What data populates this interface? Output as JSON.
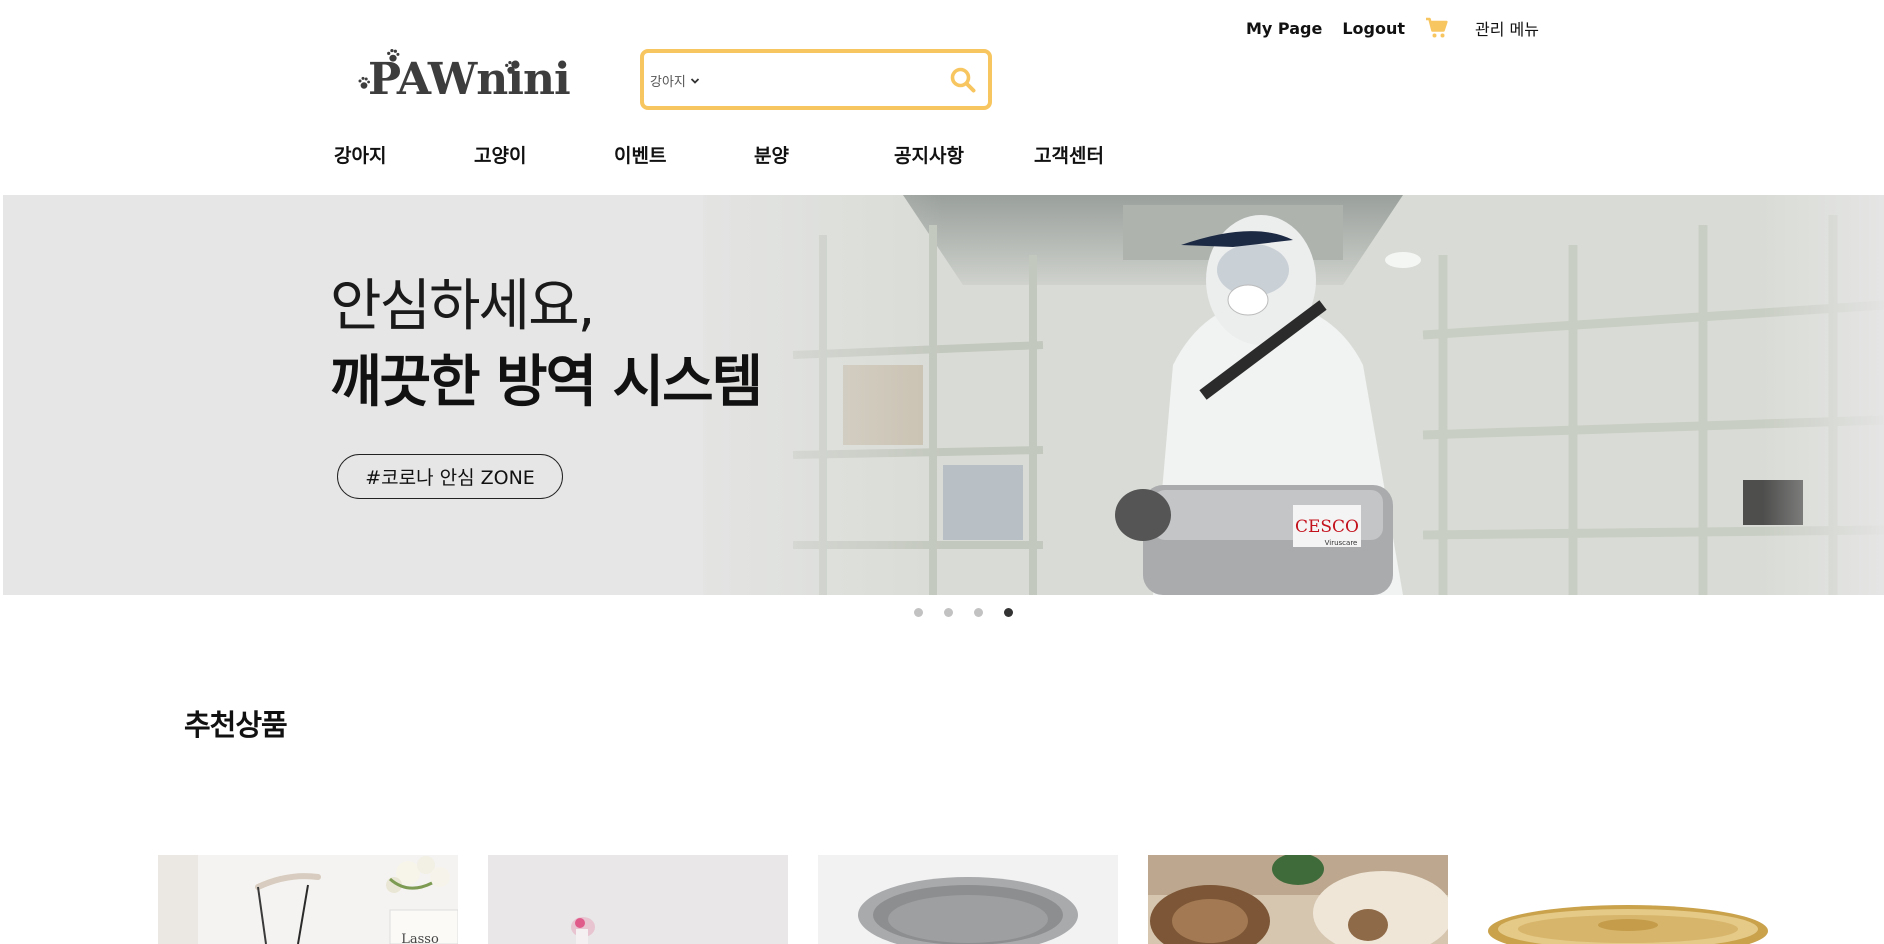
{
  "header": {
    "mypage_label": "My Page",
    "logout_label": "Logout",
    "cart_icon": "cart-icon",
    "admin_label": "관리 메뉴",
    "logo_text": "PAWnini"
  },
  "search": {
    "category_selected": "강아지",
    "placeholder": "",
    "button_icon": "search-icon"
  },
  "nav": {
    "items": [
      "강아지",
      "고양이",
      "이벤트",
      "분양",
      "공지사항",
      "고객센터"
    ]
  },
  "banner": {
    "line1": "안심하세요,",
    "line2": "깨끗한 방역 시스템",
    "tag": "#코로나 안심 ZONE",
    "photo_brand": "CESCO",
    "photo_sub": "Viruscare",
    "slides_total": 4,
    "active_slide": 4
  },
  "recommended": {
    "title": "추천상품",
    "sign_text": "Lasso"
  },
  "colors": {
    "accent": "#f8c660",
    "text": "#111111",
    "banner_bg": "#e6e6e6",
    "dot_inactive": "#c2c2c2",
    "dot_active": "#333333"
  }
}
